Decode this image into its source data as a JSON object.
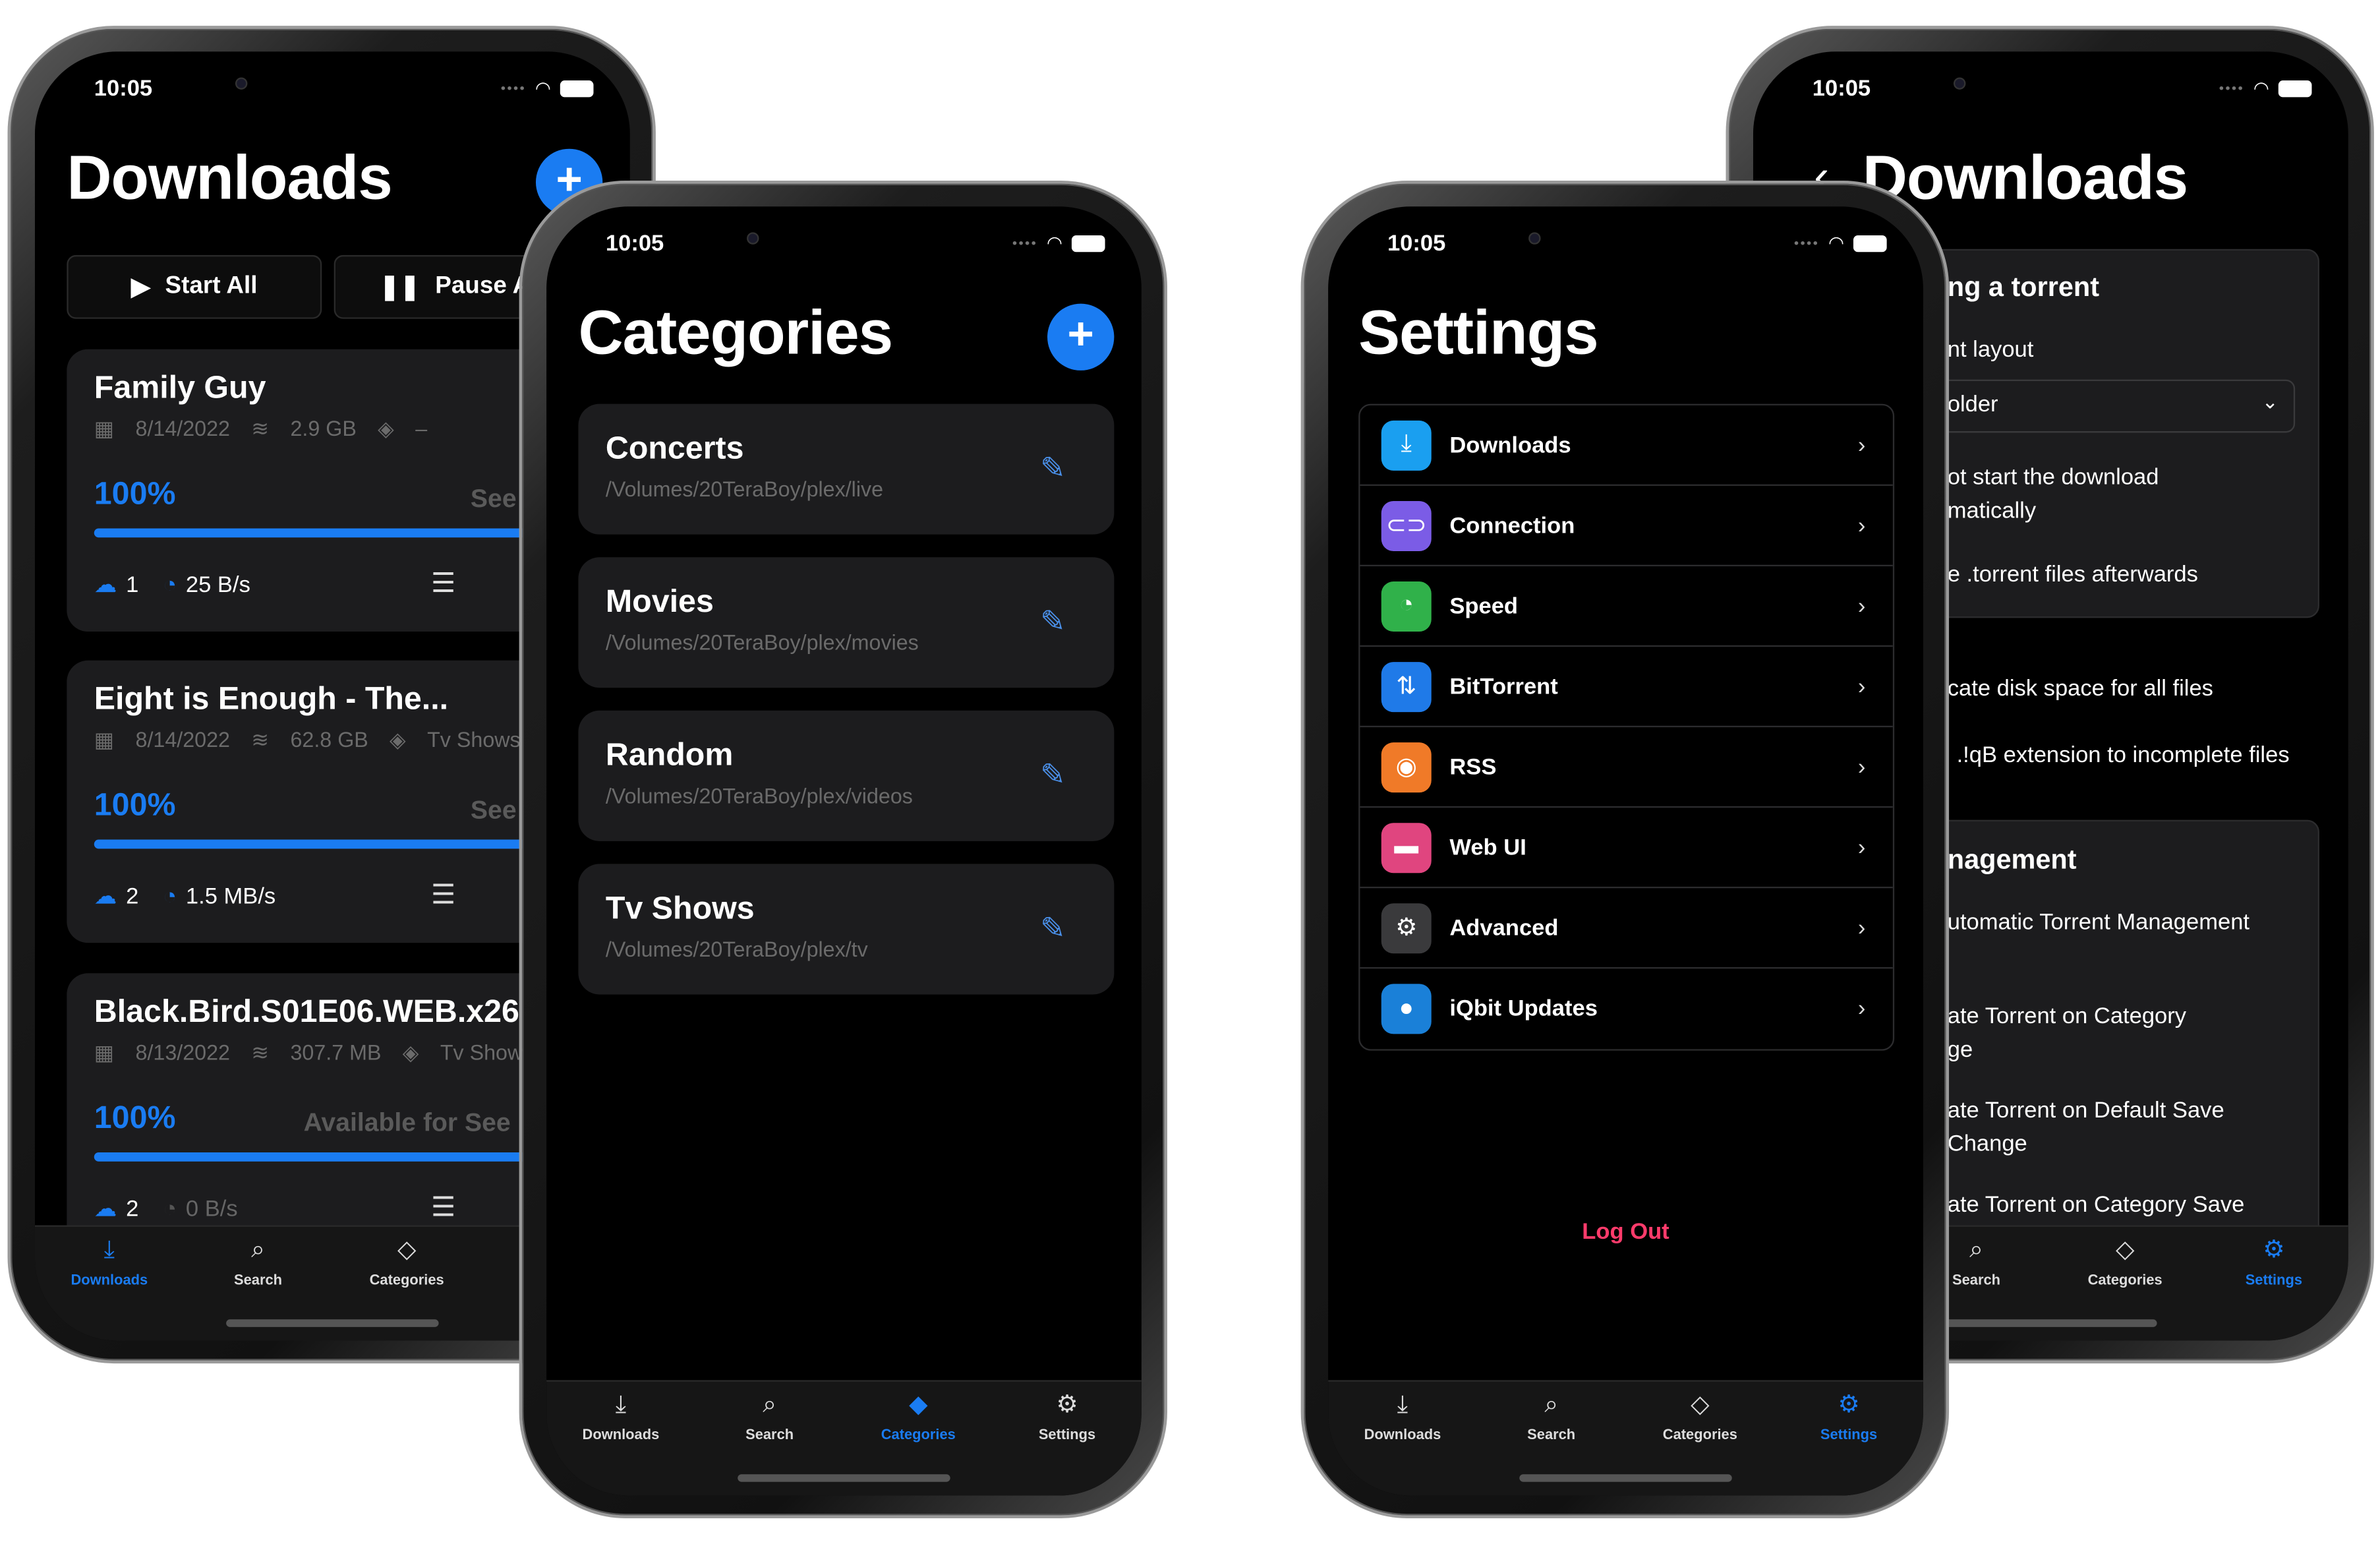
{
  "status_bar": {
    "time": "10:05"
  },
  "tabs": [
    {
      "label": "Downloads",
      "icon": "download-tray-icon"
    },
    {
      "label": "Search",
      "icon": "magnifier-icon"
    },
    {
      "label": "Categories",
      "icon": "tag-icon"
    },
    {
      "label": "Settings",
      "icon": "gear-icon"
    }
  ],
  "accent_color": "#1a7cf2",
  "downloads_screen": {
    "title": "Downloads",
    "add_label": "+",
    "start_all": "Start All",
    "pause_all": "Pause All",
    "active_tab": "Downloads",
    "torrents": [
      {
        "name": "Family Guy",
        "date": "8/14/2022",
        "size": "2.9 GB",
        "category": "–",
        "progress": "100%",
        "progress_value": 1.0,
        "state": "See",
        "seeds": "1",
        "speed": "25 B/s"
      },
      {
        "name": "Eight is Enough - The...",
        "date": "8/14/2022",
        "size": "62.8 GB",
        "category": "Tv Shows",
        "progress": "100%",
        "progress_value": 1.0,
        "state": "See",
        "seeds": "2",
        "speed": "1.5 MB/s"
      },
      {
        "name": "Black.Bird.S01E06.WEB.x26",
        "date": "8/13/2022",
        "size": "307.7 MB",
        "category": "Tv Shows",
        "progress": "100%",
        "progress_value": 1.0,
        "state": "Available for See",
        "seeds": "2",
        "speed": "0 B/s"
      }
    ]
  },
  "categories_screen": {
    "title": "Categories",
    "add_label": "+",
    "active_tab": "Categories",
    "items": [
      {
        "name": "Concerts",
        "path": "/Volumes/20TeraBoy/plex/live"
      },
      {
        "name": "Movies",
        "path": "/Volumes/20TeraBoy/plex/movies"
      },
      {
        "name": "Random",
        "path": "/Volumes/20TeraBoy/plex/videos"
      },
      {
        "name": "Tv Shows",
        "path": "/Volumes/20TeraBoy/plex/tv"
      }
    ]
  },
  "settings_screen": {
    "title": "Settings",
    "active_tab": "Settings",
    "items": [
      {
        "label": "Downloads",
        "icon": "download-icon",
        "color": "#1a9ff0"
      },
      {
        "label": "Connection",
        "icon": "link-icon",
        "color": "#7b5ce6"
      },
      {
        "label": "Speed",
        "icon": "speedometer-icon",
        "color": "#30b14a"
      },
      {
        "label": "BitTorrent",
        "icon": "arrows-swap-icon",
        "color": "#1f7ae8"
      },
      {
        "label": "RSS",
        "icon": "rss-icon",
        "color": "#f07a28"
      },
      {
        "label": "Web UI",
        "icon": "window-icon",
        "color": "#e0457f"
      },
      {
        "label": "Advanced",
        "icon": "gear-icon",
        "color": "#3a3a3c"
      },
      {
        "label": "iQbit Updates",
        "icon": "chat-bubble-icon",
        "color": "#1a80d8"
      }
    ],
    "logout": "Log Out"
  },
  "download_settings_screen": {
    "title": "Downloads",
    "back_icon": "chevron-left-icon",
    "active_tab": "Settings",
    "fragments": {
      "section1": "ng a torrent",
      "layout_label": "nt layout",
      "layout_value": "older",
      "no_autostart_1": "ot start the download",
      "no_autostart_2": "matically",
      "delete_torrent": "e .torrent files afterwards",
      "preallocate": "cate disk space for all files",
      "append_ext": ".!qB extension to incomplete files",
      "section2": "nagement",
      "auto_tmm": "utomatic Torrent Management",
      "cat_change_1": "ate Torrent on Category",
      "cat_change_2": "ge",
      "default_save_1": "ate Torrent on Default Save",
      "default_save_2": "Change",
      "cat_save": "ate Torrent on Category Save"
    }
  }
}
